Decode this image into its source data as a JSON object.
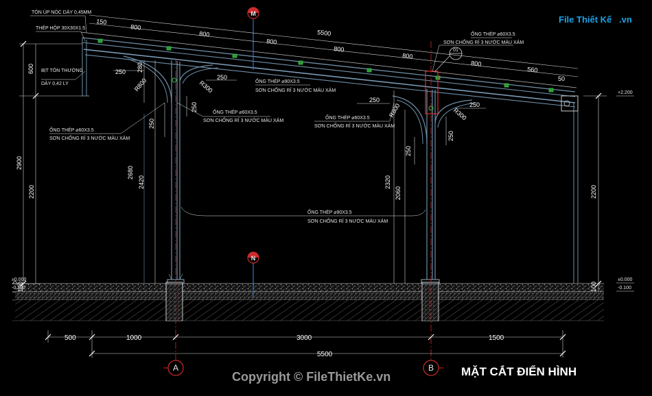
{
  "logo": {
    "text": "File Thiết Kế",
    "suffix": ".vn"
  },
  "title": "MẶT CẮT ĐIỂN HÌNH",
  "copyright": "Copyright © FileThietKe.vn",
  "axes": {
    "a": "A",
    "b": "B",
    "m": "M",
    "n": "N",
    "detail": "01"
  },
  "notes": {
    "roof_cap": "TÔN ÚP NÓC DÀY 0,45MM",
    "box_steel": "THÉP HỘP 30X30X1.5",
    "trim": "BỊT TÔN THƯỜNG",
    "trim_thk": "DÀY 0,42 LY",
    "pipe60_left_title": "ỐNG THÉP ⌀60X3.5",
    "pipe60_left_paint": "SƠN CHỐNG RỈ 3 NƯỚC MÀU XÁM",
    "pipe60_mid_title": "ỐNG THÉP ⌀60X3.5",
    "pipe60_mid_paint": "SƠN CHỐNG RỈ 3 NƯỚC MÀU XÁM",
    "pipe90_top_title": "ỐNG THÉP ⌀90X3.5",
    "pipe90_top_paint": "SƠN CHỐNG RỈ 3 NƯỚC MÀU XÁM",
    "pipe60_right_title": "ỐNG THÉP ⌀60X3.5",
    "pipe60_right_paint": "SƠN CHỐNG RỈ 3 NƯỚC MÀU XÁM",
    "pipe60_b_title": "ỐNG THÉP ⌀60X3.5",
    "pipe60_b_paint": "SƠN CHỐNG RỈ 3 NƯỚC MÀU XÁM",
    "pipe90_low_title": "ỐNG THÉP ⌀90X3.5",
    "pipe90_low_paint": "SƠN CHỐNG RỈ 3 NƯỚC MÀU XÁM"
  },
  "dims": {
    "top_150": "150",
    "purlins": [
      "800",
      "800",
      "800",
      "800",
      "800",
      "800",
      "560"
    ],
    "top_total": "5500",
    "end_50": "50",
    "h600": "600",
    "h2900": "2900",
    "h2200": "2200",
    "h280": "280",
    "h2680": "2680",
    "h2420": "2420",
    "h250a": "250",
    "h250b": "250",
    "h2320": "2320",
    "h2060": "2060",
    "h250c": "250",
    "h250d": "250",
    "h2200_right": "2200",
    "h100_left": "100",
    "h100_right": "100",
    "w250_a": "250",
    "w250_b": "250",
    "w250_c": "250",
    "w250_d": "250",
    "r800_a": "R800",
    "r300_a": "R300",
    "r800_b": "R800",
    "r300_b": "R300",
    "bottom": [
      "500",
      "1000",
      "3000",
      "1500"
    ],
    "bottom_total": "5500"
  },
  "levels": {
    "left_zero": "±0.000",
    "left_minus": "-0.100",
    "right_top": "+2.200",
    "right_zero": "±0.000",
    "right_minus": "-0.100"
  },
  "colors": {
    "structure": "#6f8fa8",
    "dim_line": "#d8d8d8",
    "axis": "#cc2b2b",
    "gravel": "#8a8a8a",
    "soil": "#4a4a4a",
    "purlin": "#2e9a3a",
    "blue": "#2f6fd4"
  }
}
